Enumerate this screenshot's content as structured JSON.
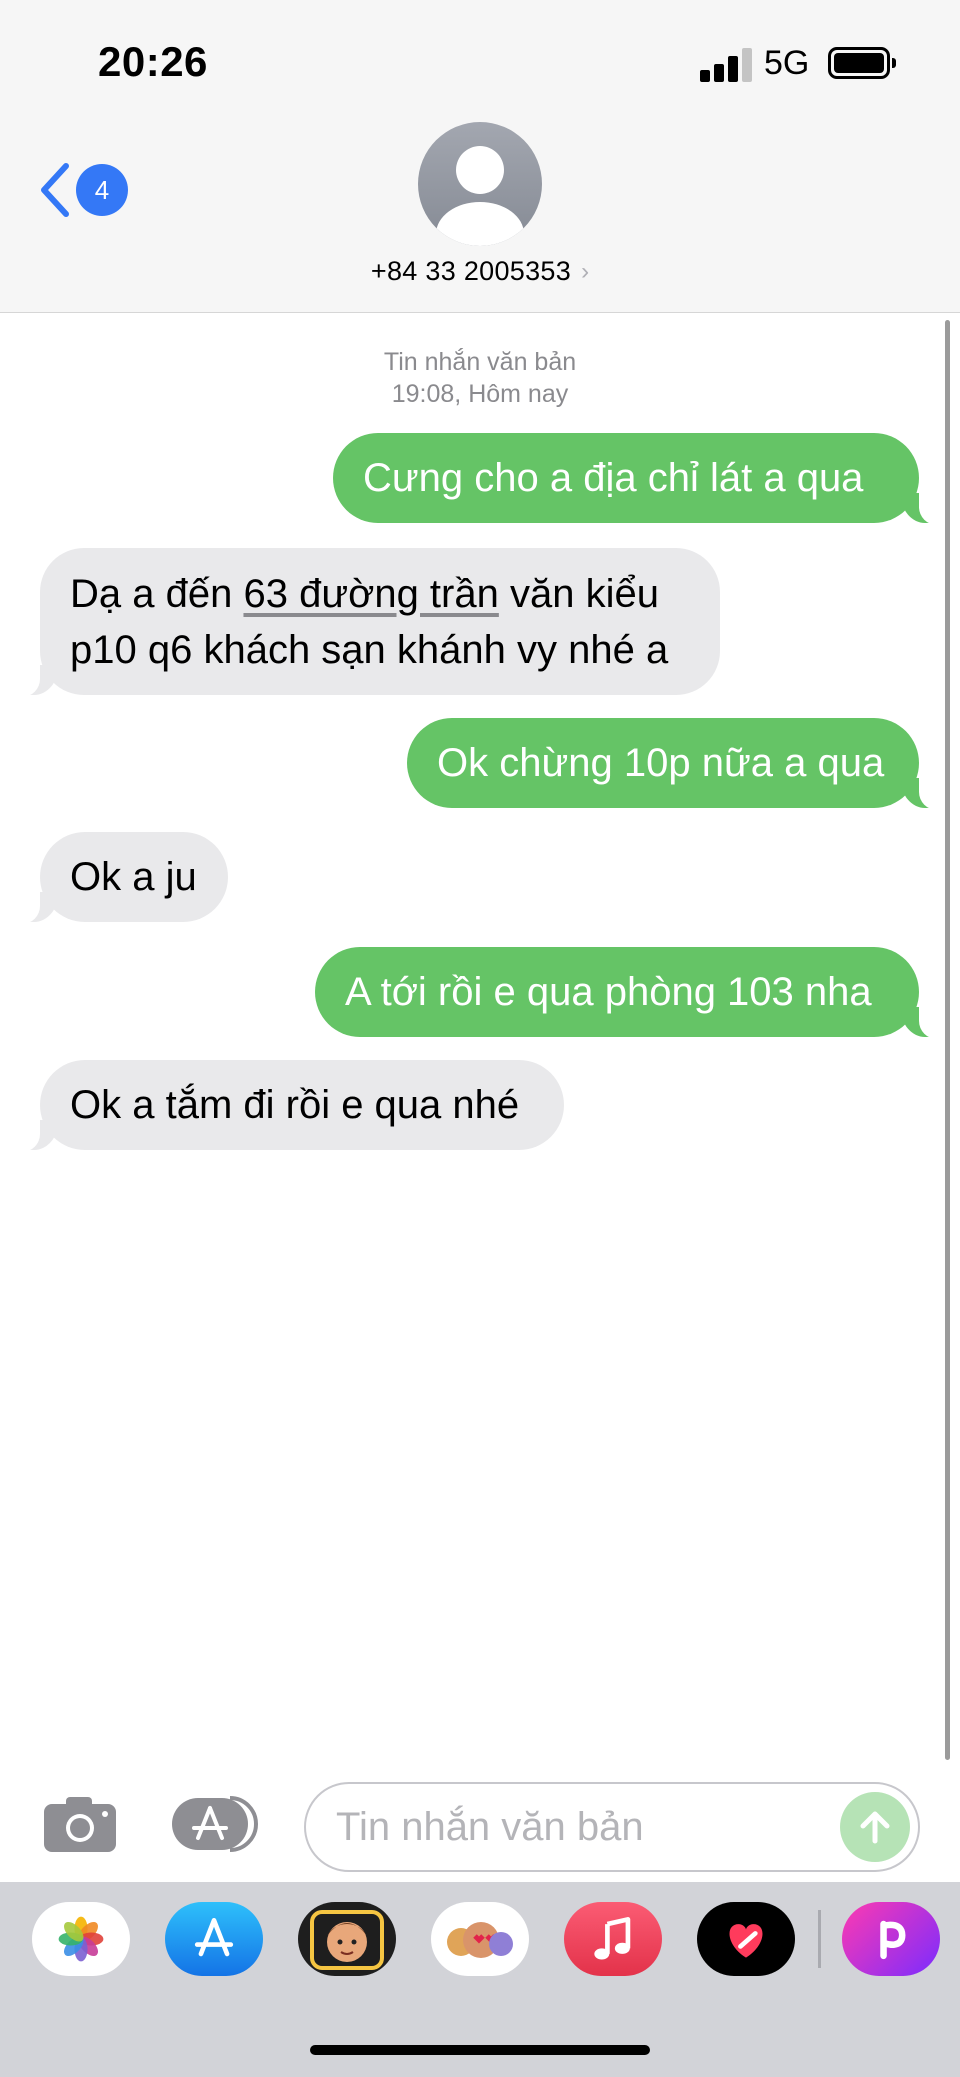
{
  "status_bar": {
    "time": "20:26",
    "network": "5G",
    "signal_icon": "cellular-signal-icon",
    "battery_icon": "battery-icon",
    "battery_level": 0.9
  },
  "header": {
    "back_icon": "chevron-left-icon",
    "unread_count": "4",
    "avatar_icon": "person-silhouette-icon",
    "contact_number": "+84 33 2005353",
    "contact_chevron": "›"
  },
  "thread": {
    "kind": "Tin nhắn văn bản",
    "timestamp": "19:08, Hôm nay",
    "messages": [
      {
        "direction": "sent",
        "text": "Cưng cho a địa chỉ lát a qua"
      },
      {
        "direction": "received",
        "line1_prefix": "Dạ a đến ",
        "line1_link": "63 đường trần",
        "line1_suffix": " văn kiểu",
        "line2": "p10 q6 khách sạn khánh vy nhé a"
      },
      {
        "direction": "sent",
        "text": "Ok chừng 10p nữa a qua"
      },
      {
        "direction": "received",
        "text": "Ok a ju"
      },
      {
        "direction": "sent",
        "text": "A tới rồi e qua phòng 103 nha"
      },
      {
        "direction": "received",
        "text": "Ok a tắm đi rồi e qua nhé"
      }
    ]
  },
  "compose": {
    "camera_icon": "camera-icon",
    "apps_icon": "app-store-icon",
    "placeholder": "Tin nhắn văn bản",
    "send_icon": "arrow-up-icon"
  },
  "app_drawer": {
    "apps": [
      "photos-icon",
      "app-store-icon",
      "memoji-icon",
      "animoji-stickers-icon",
      "music-icon",
      "digital-touch-icon",
      "picsart-icon"
    ]
  },
  "colors": {
    "sent_bubble": "#65c466",
    "received_bubble": "#e9e9eb",
    "accent_blue": "#3478f6",
    "header_bg": "#f6f6f6",
    "drawer_bg": "#d2d3d8"
  }
}
